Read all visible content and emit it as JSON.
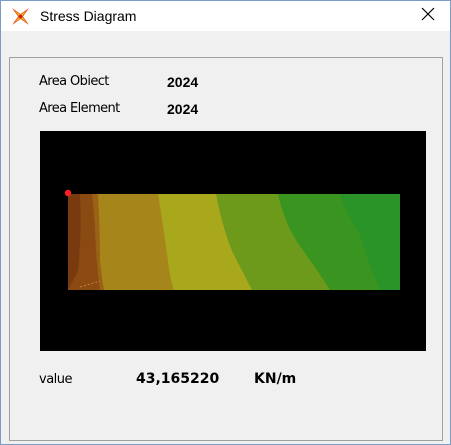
{
  "window": {
    "title": "Stress Diagram",
    "app_icon": "sap-app-icon",
    "close_glyph": "✕"
  },
  "info": {
    "area_object_label": "Area Obiect",
    "area_object_value": "2024",
    "area_element_label": "Area Element",
    "area_element_value": "2024"
  },
  "diagram": {
    "background": "#000000",
    "bands": [
      "#7a3a10",
      "#8a4a12",
      "#9a6216",
      "#a6861a",
      "#a9a81c",
      "#6e9a1c",
      "#3a9420",
      "#2a9428"
    ],
    "selected_point_color": "#ff2020"
  },
  "readout": {
    "label": "value",
    "value": "43,165220",
    "unit": "KN/m"
  }
}
